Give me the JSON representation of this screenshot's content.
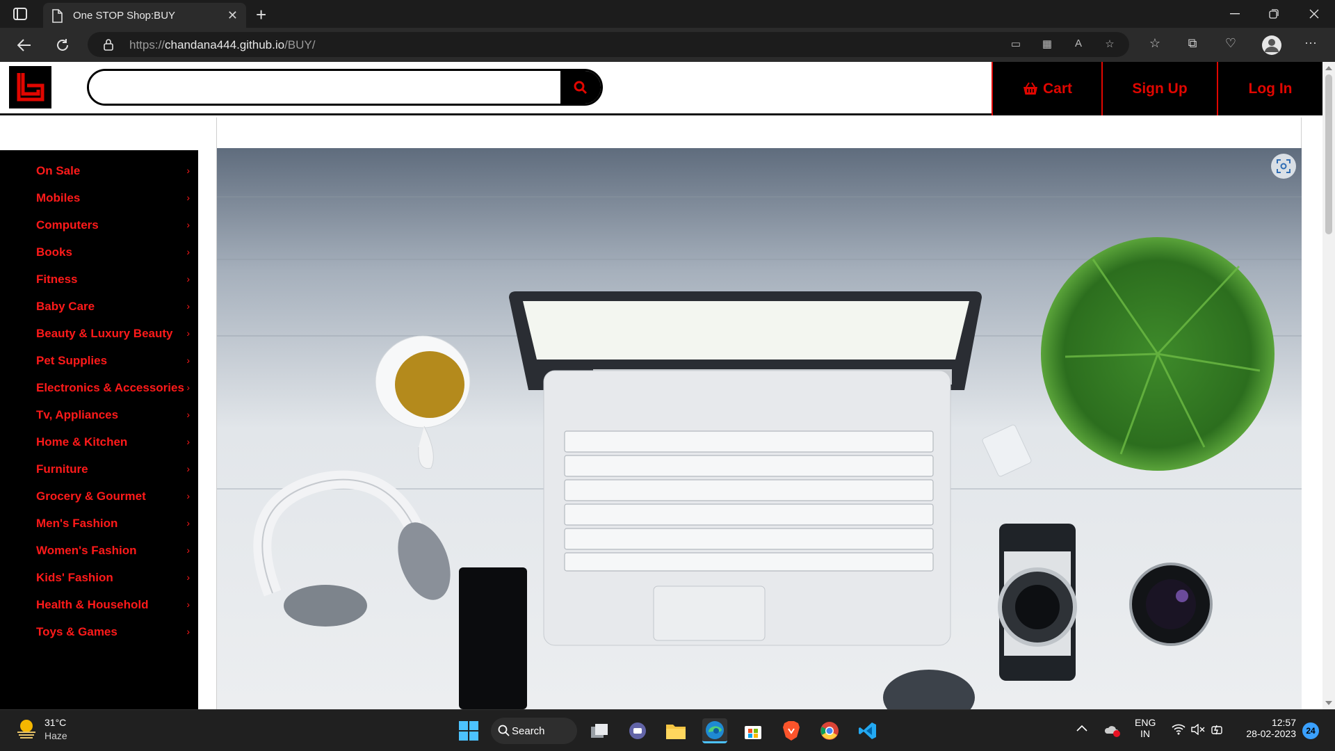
{
  "browser": {
    "tab_title": "One STOP Shop:BUY",
    "url_prefix": "https://",
    "url_host": "chandana444.github.io",
    "url_path": "/BUY/"
  },
  "site": {
    "search": {
      "value": "",
      "placeholder": ""
    },
    "header_buttons": {
      "cart": "Cart",
      "signup": "Sign Up",
      "login": "Log In"
    },
    "accent_color": "#e10600",
    "categories": [
      "On Sale",
      "Mobiles",
      "Computers",
      "Books",
      "Fitness",
      "Baby Care",
      "Beauty & Luxury Beauty",
      "Pet Supplies",
      "Electronics & Accessories",
      "Tv, Appliances",
      "Home & Kitchen",
      "Furniture",
      "Grocery & Gourmet",
      "Men's Fashion",
      "Women's Fashion",
      "Kids' Fashion",
      "Health & Household",
      "Toys & Games"
    ]
  },
  "taskbar": {
    "weather_temp": "31°C",
    "weather_desc": "Haze",
    "search_label": "Search",
    "lang_top": "ENG",
    "lang_bottom": "IN",
    "time": "12:57",
    "date": "28-02-2023",
    "notification_count": "24"
  }
}
